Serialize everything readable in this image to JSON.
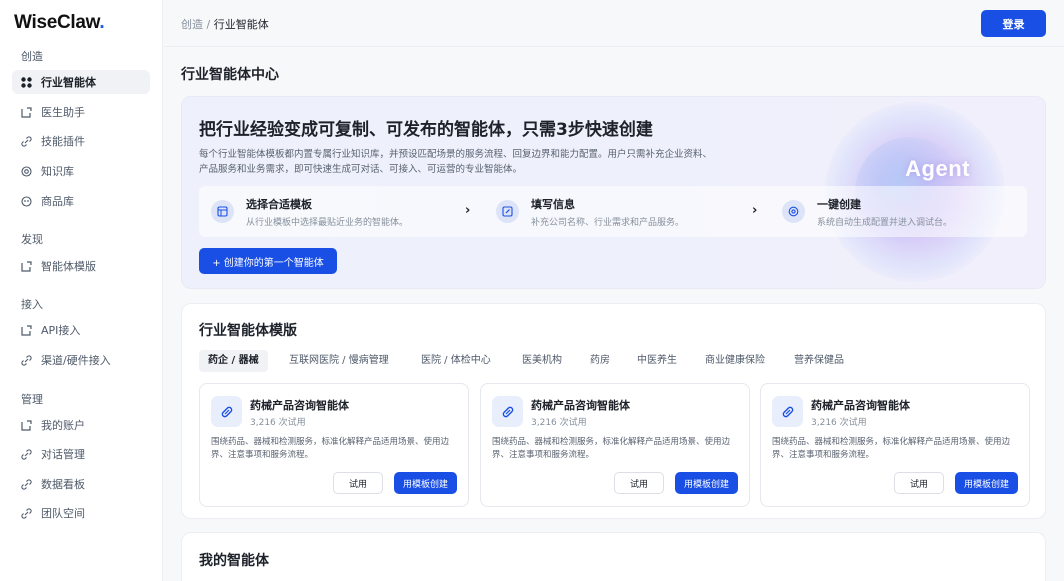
{
  "app": {
    "logo": "WiseClaw",
    "logo_dot": "."
  },
  "sidebar": {
    "sections": [
      {
        "title": "创造",
        "items": [
          {
            "label": "行业智能体",
            "icon": "grid-icon",
            "active": true
          },
          {
            "label": "医生助手",
            "icon": "box-icon"
          },
          {
            "label": "技能插件",
            "icon": "link-icon"
          },
          {
            "label": "知识库",
            "icon": "target-icon"
          },
          {
            "label": "商品库",
            "icon": "clock-icon"
          }
        ]
      },
      {
        "title": "发现",
        "items": [
          {
            "label": "智能体模版",
            "icon": "box-icon"
          }
        ]
      },
      {
        "title": "接入",
        "items": [
          {
            "label": "API接入",
            "icon": "box-icon"
          },
          {
            "label": "渠道/硬件接入",
            "icon": "link-icon"
          }
        ]
      },
      {
        "title": "管理",
        "items": [
          {
            "label": "我的账户",
            "icon": "box-icon"
          },
          {
            "label": "对话管理",
            "icon": "link-icon"
          },
          {
            "label": "数据看板",
            "icon": "link-icon"
          },
          {
            "label": "团队空间",
            "icon": "link-icon"
          }
        ]
      }
    ]
  },
  "topbar": {
    "breadcrumb_parent": "创造",
    "breadcrumb_sep": " / ",
    "breadcrumb_current": "行业智能体",
    "login_label": "登录"
  },
  "page_title": "行业智能体中心",
  "hero": {
    "title": "把行业经验变成可复制、可发布的智能体，只需3步快速创建",
    "description": "每个行业智能体模板都内置专属行业知识库，并预设匹配场景的服务流程、回复边界和能力配置。用户只需补充企业资料、产品服务和业务需求，即可快速生成可对话、可接入、可运营的专业智能体。",
    "badge": "Agent",
    "steps": [
      {
        "title": "选择合适模板",
        "desc": "从行业模板中选择最贴近业务的智能体。",
        "icon": "template-icon"
      },
      {
        "title": "填写信息",
        "desc": "补充公司名称、行业需求和产品服务。",
        "icon": "edit-icon"
      },
      {
        "title": "一键创建",
        "desc": "系统自动生成配置并进入调试台。",
        "icon": "at-icon"
      }
    ],
    "create_label": "+ 创建你的第一个智能体"
  },
  "templates": {
    "title": "行业智能体模版",
    "tabs": [
      "药企 / 器械",
      "互联网医院 / 慢病管理",
      "医院 / 体检中心",
      "医美机构",
      "药房",
      "中医养生",
      "商业健康保险",
      "营养保健品"
    ],
    "active_tab": 0,
    "cards": [
      {
        "title": "药械产品咨询智能体",
        "uses": "3,216 次试用",
        "desc": "围绕药品、器械和检测服务，标准化解释产品适用场景、使用边界、注意事项和服务流程。",
        "try_label": "试用",
        "use_label": "用模板创建"
      },
      {
        "title": "药械产品咨询智能体",
        "uses": "3,216 次试用",
        "desc": "围绕药品、器械和检测服务，标准化解释产品适用场景、使用边界、注意事项和服务流程。",
        "try_label": "试用",
        "use_label": "用模板创建"
      },
      {
        "title": "药械产品咨询智能体",
        "uses": "3,216 次试用",
        "desc": "围绕药品、器械和检测服务，标准化解释产品适用场景、使用边界、注意事项和服务流程。",
        "try_label": "试用",
        "use_label": "用模板创建"
      }
    ]
  },
  "my_agents": {
    "title": "我的智能体"
  },
  "colors": {
    "primary": "#1a4fe6",
    "active_bg": "#f0f2f5"
  }
}
